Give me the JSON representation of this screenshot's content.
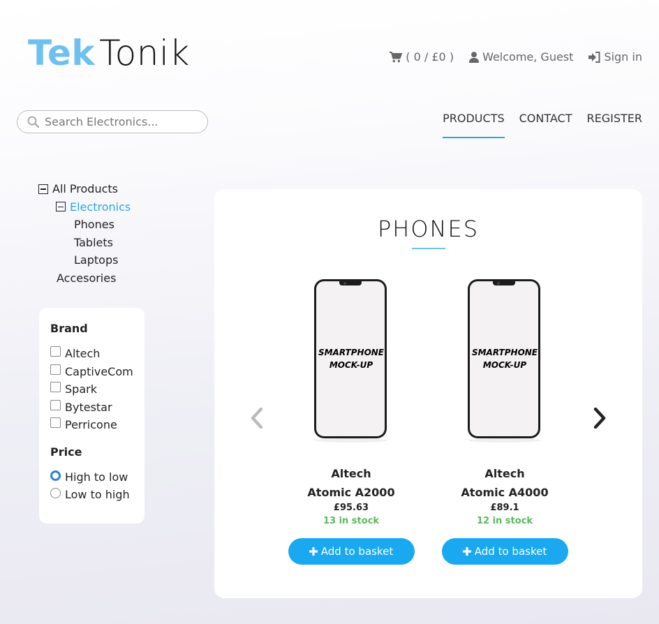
{
  "header": {
    "logo_part1": "Tek",
    "logo_part2": "Tonik",
    "cart": "( 0 / £0 )",
    "welcome": "Welcome, Guest",
    "sign_in": "Sign in"
  },
  "search": {
    "placeholder": "Search Electronics..."
  },
  "nav": {
    "products": "PRODUCTS",
    "contact": "CONTACT",
    "register": "REGISTER",
    "active": "PRODUCTS"
  },
  "categories": {
    "all": "All Products",
    "electronics": "Electronics",
    "phones": "Phones",
    "tablets": "Tablets",
    "laptops": "Laptops",
    "accessories": "Accesories"
  },
  "filters": {
    "brand_title": "Brand",
    "brands": [
      "Altech",
      "CaptiveCom",
      "Spark",
      "Bytestar",
      "Perricone"
    ],
    "price_title": "Price",
    "price_options": [
      "High to low",
      "Low to high"
    ],
    "price_selected": "High to low"
  },
  "panel": {
    "heading": "PHONES",
    "products": [
      {
        "brand": "Altech",
        "model": "Atomic A2000",
        "price": "£95.63",
        "stock": "13 in stock",
        "button": "Add to basket",
        "image_text_1": "SMARTPHONE",
        "image_text_2": "MOCK-UP"
      },
      {
        "brand": "Altech",
        "model": "Atomic A4000",
        "price": "£89.1",
        "stock": "12 in stock",
        "button": "Add to basket",
        "image_text_1": "SMARTPHONE",
        "image_text_2": "MOCK-UP"
      }
    ]
  },
  "colors": {
    "accent": "#2aa8e0",
    "logo": "#6ec1ee",
    "button": "#1aa9f0",
    "stock": "#5cb85c"
  },
  "icons": [
    "cart-icon",
    "user-icon",
    "sign-in-icon",
    "search-icon",
    "chevron-left-icon",
    "chevron-right-icon",
    "plus-icon"
  ]
}
